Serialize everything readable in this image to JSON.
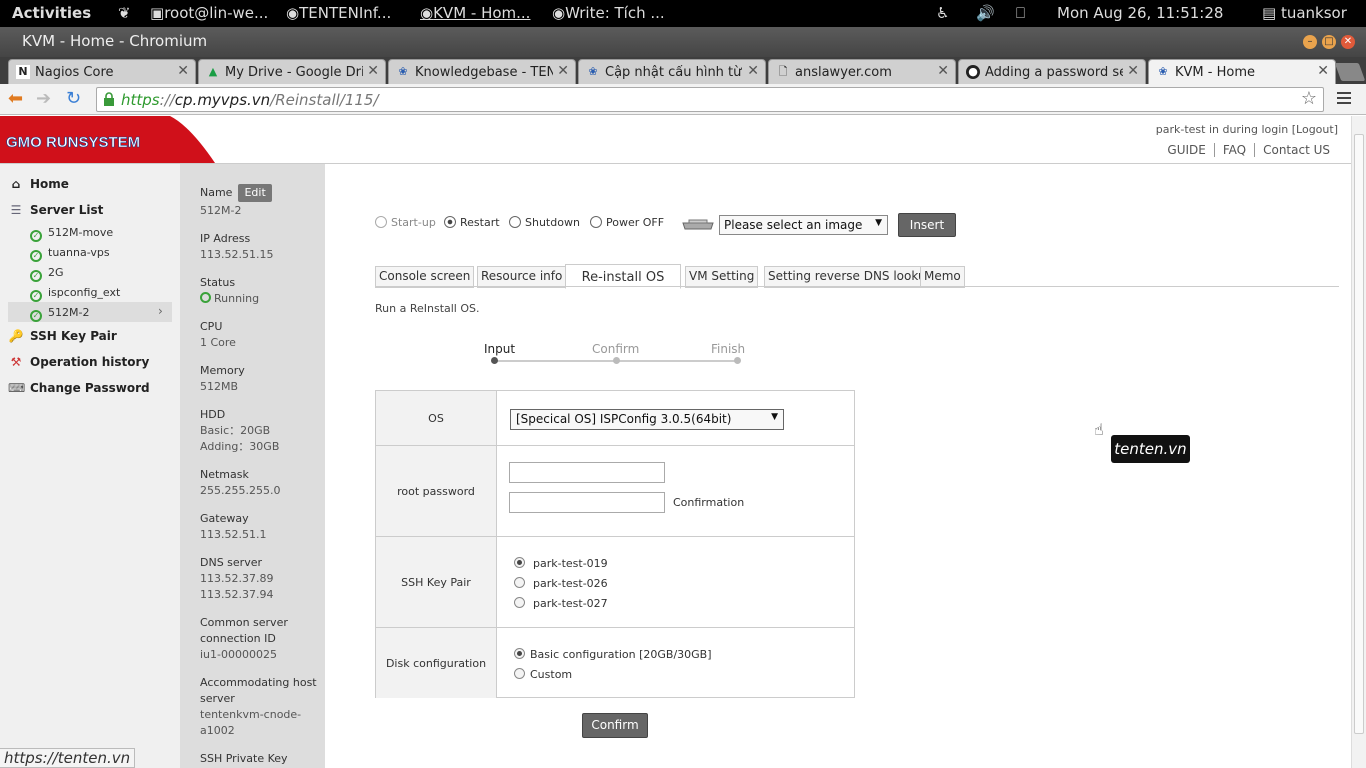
{
  "topbar": {
    "activities": "Activities",
    "windows": [
      "root@lin-we...",
      "TENTENInf...",
      "KVM - Hom...",
      "Write: Tích ..."
    ],
    "datetime": "Mon Aug 26, 11:51:28",
    "user": "tuanksor"
  },
  "window": {
    "title": "KVM - Home - Chromium"
  },
  "tabs": [
    {
      "label": "Nagios Core",
      "icon": "nagios-icon"
    },
    {
      "label": "My Drive - Google Drive",
      "icon": "google-drive-icon"
    },
    {
      "label": "Knowledgebase - TENTEN",
      "icon": "kvm-icon"
    },
    {
      "label": "Cập nhật cấu hình từ",
      "icon": "kvm-icon"
    },
    {
      "label": "anslawyer.com",
      "icon": "page-icon"
    },
    {
      "label": "Adding a password se",
      "icon": "github-icon"
    },
    {
      "label": "KVM - Home",
      "icon": "kvm-icon"
    }
  ],
  "address": {
    "protocol": "https",
    "host": "cp.myvps.vn",
    "path": "/Reinstall/115/"
  },
  "header": {
    "logo": "GMO RUNSYSTEM",
    "login_text": "park-test in during login [Logout]",
    "links": [
      "GUIDE",
      "FAQ",
      "Contact US"
    ]
  },
  "sidebar": {
    "home": "Home",
    "server_list": "Server List",
    "servers": [
      "512M-move",
      "tuanna-vps",
      "2G",
      "ispconfig_ext",
      "512M-2"
    ],
    "ssh_key_pair": "SSH Key Pair",
    "operation_history": "Operation history",
    "change_password": "Change Password"
  },
  "info": {
    "name_label": "Name",
    "edit": "Edit",
    "name": "512M-2",
    "ip_label": "IP Adress",
    "ip": "113.52.51.15",
    "status_label": "Status",
    "status": "Running",
    "cpu_label": "CPU",
    "cpu": "1 Core",
    "memory_label": "Memory",
    "memory": "512MB",
    "hdd_label": "HDD",
    "hdd_basic": "Basic：20GB",
    "hdd_adding": "Adding：30GB",
    "netmask_label": "Netmask",
    "netmask": "255.255.255.0",
    "gateway_label": "Gateway",
    "gateway": "113.52.51.1",
    "dns_label": "DNS server",
    "dns1": "113.52.37.89",
    "dns2": "113.52.37.94",
    "common_label_1": "Common server",
    "common_label_2": "connection ID",
    "common": "iu1-00000025",
    "host_label_1": "Accommodating host",
    "host_label_2": "server",
    "host_1": "tentenkvm-cnode-",
    "host_2": "a1002",
    "ssh_private_label": "SSH Private Key"
  },
  "toolbar": {
    "startup": "Start-up",
    "restart": "Restart",
    "shutdown": "Shutdown",
    "poweroff": "Power OFF",
    "image_select": "Please select an image",
    "insert": "Insert"
  },
  "vm_tabs": [
    "Console screen",
    "Resource info",
    "Re-install OS",
    "VM Setting",
    "Setting reverse DNS lookup",
    "Memo"
  ],
  "reinstall": {
    "intro": "Run a ReInstall OS.",
    "steps": [
      "Input",
      "Confirm",
      "Finish"
    ],
    "os_label": "OS",
    "os_value": "[Specical OS] ISPConfig 3.0.5(64bit)",
    "root_password_label": "root password",
    "confirmation": "Confirmation",
    "ssh_label": "SSH Key Pair",
    "ssh_keys": [
      "park-test-019",
      "park-test-026",
      "park-test-027"
    ],
    "disk_label": "Disk configuration",
    "disk_options": [
      "Basic configuration [20GB/30GB]",
      "Custom"
    ],
    "confirm_button": "Confirm"
  },
  "tooltip": "tenten.vn",
  "status_url": "https://tenten.vn"
}
